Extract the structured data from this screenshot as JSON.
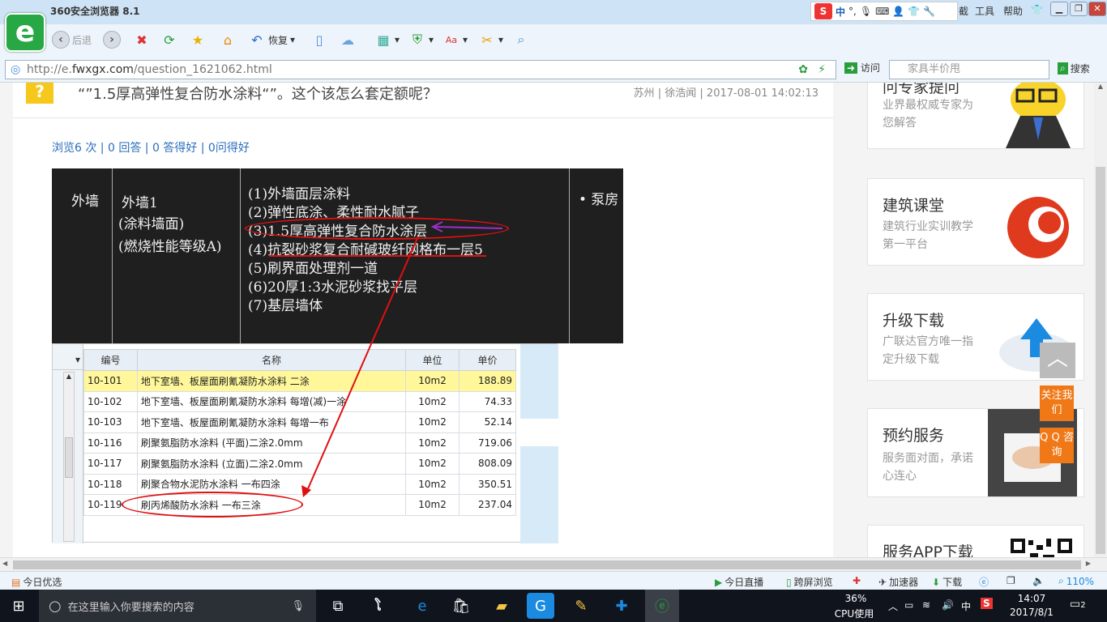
{
  "browser": {
    "title": "360安全浏览器 8.1",
    "menu": [
      "工具",
      "帮助"
    ],
    "menu_partial": "截",
    "ime_label": "中",
    "nav": {
      "back": "后退",
      "restore": "恢复"
    },
    "address": {
      "prefix": "http://e.",
      "domain": "fwxgx.com",
      "path": "/question_1621062.html"
    },
    "visit_label": "访问",
    "search_placeholder": "家具半价甩",
    "search_label": "搜索"
  },
  "question": {
    "title": "“”1.5厚高弹性复合防水涂料“”。这个该怎么套定额呢？",
    "meta": "苏州 | 徐浩闻 | 2017-08-01 14:02:13",
    "stats": "浏览6 次 | 0 回答 | 0 答得好 | 0问得好"
  },
  "drawing": {
    "col1": "外墙",
    "col2": [
      "外墙1",
      "(涂料墙面)",
      "(燃烧性能等级A)"
    ],
    "col3": [
      "(1)外墙面层涂料",
      "(2)弹性底涂、柔性耐水腻子",
      "(3)1.5厚高弹性复合防水涂层",
      "(4)抗裂砂浆复合耐碱玻纤网格布一层5",
      "(5)刷界面处理剂一道",
      "(6)20厚1:3水泥砂浆找平层",
      "(7)基层墙体"
    ],
    "col4": "• 泵房"
  },
  "quota_table": {
    "headers": [
      "编号",
      "名称",
      "单位",
      "单价"
    ],
    "rows": [
      {
        "code": "10-101",
        "name": "地下室墙、板屋面刷氰凝防水涂料 二涂",
        "unit": "10m2",
        "price": "188.89"
      },
      {
        "code": "10-102",
        "name": "地下室墙、板屋面刷氰凝防水涂料 每增(减)一涂",
        "unit": "10m2",
        "price": "74.33"
      },
      {
        "code": "10-103",
        "name": "地下室墙、板屋面刷氰凝防水涂料 每增一布",
        "unit": "10m2",
        "price": "52.14"
      },
      {
        "code": "10-116",
        "name": "刷聚氨脂防水涂料 (平面)二涂2.0mm",
        "unit": "10m2",
        "price": "719.06"
      },
      {
        "code": "10-117",
        "name": "刷聚氨脂防水涂料 (立面)二涂2.0mm",
        "unit": "10m2",
        "price": "808.09"
      },
      {
        "code": "10-118",
        "name": "刷聚合物水泥防水涂料 一布四涂",
        "unit": "10m2",
        "price": "350.51"
      },
      {
        "code": "10-119",
        "name": "刷丙烯酸防水涂料 一布三涂",
        "unit": "10m2",
        "price": "237.04"
      }
    ]
  },
  "sidebar": {
    "card0": {
      "title": "问专家提问",
      "desc": "业界最权威专家为您解答"
    },
    "card1": {
      "title": "建筑课堂",
      "desc": "建筑行业实训教学第一平台"
    },
    "card2": {
      "title": "升级下载",
      "desc": "广联达官方唯一指定升级下载"
    },
    "card3": {
      "title": "预约服务",
      "desc": "服务面对面，承诺心连心"
    },
    "card4": {
      "title": "服务APP下载"
    }
  },
  "float": {
    "follow": "关注我们",
    "qq": "Q Q 咨询",
    "top": "︿"
  },
  "statusbar": {
    "today": "今日优选",
    "live": "今日直播",
    "cross": "跨屏浏览",
    "accel": "加速器",
    "download": "下载",
    "zoom": "110%"
  },
  "taskbar": {
    "search_placeholder": "在这里输入你要搜索的内容",
    "cpu": "36%",
    "cpu_label": "CPU使用",
    "ime": "中",
    "time": "14:07",
    "date": "2017/8/1",
    "notif": "2"
  }
}
